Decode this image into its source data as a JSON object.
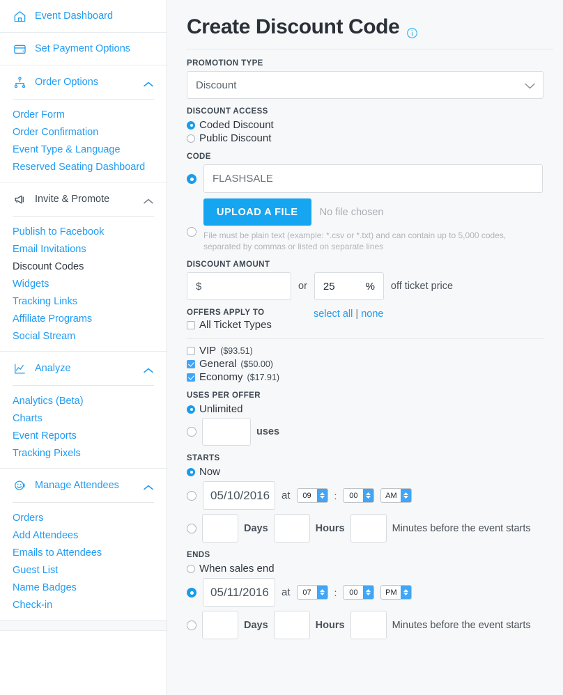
{
  "sidebar": {
    "top_items": [
      {
        "label": "Event Dashboard",
        "icon": "home-icon"
      },
      {
        "label": "Set Payment Options",
        "icon": "credit-card-icon"
      }
    ],
    "groups": [
      {
        "label": "Order Options",
        "icon": "sitemap-icon",
        "chevron": "chevron-up-icon",
        "active": false,
        "items": [
          "Order Form",
          "Order Confirmation",
          "Event Type & Language",
          "Reserved Seating Dashboard"
        ]
      },
      {
        "label": "Invite & Promote",
        "icon": "megaphone-icon",
        "chevron": "chevron-up-icon",
        "active": true,
        "items": [
          "Publish to Facebook",
          "Email Invitations",
          "Discount Codes",
          "Widgets",
          "Tracking Links",
          "Affiliate Programs",
          "Social Stream"
        ],
        "active_item": "Discount Codes"
      },
      {
        "label": "Analyze",
        "icon": "chart-line-icon",
        "chevron": "chevron-up-icon",
        "active": false,
        "items": [
          "Analytics (Beta)",
          "Charts",
          "Event Reports",
          "Tracking Pixels"
        ]
      },
      {
        "label": "Manage Attendees",
        "icon": "smiley-face-icon",
        "chevron": "chevron-up-icon",
        "active": false,
        "items": [
          "Orders",
          "Add Attendees",
          "Emails to Attendees",
          "Guest List",
          "Name Badges",
          "Check-in"
        ]
      }
    ]
  },
  "page": {
    "title": "Create Discount Code",
    "info_icon": "info-circle-icon"
  },
  "promotion_type": {
    "label": "PROMOTION TYPE",
    "value": "Discount",
    "chevron": "chevron-down-icon"
  },
  "discount_access": {
    "label": "DISCOUNT ACCESS",
    "options": [
      {
        "label": "Coded Discount",
        "selected": true
      },
      {
        "label": "Public Discount",
        "selected": false
      }
    ]
  },
  "code": {
    "label": "CODE",
    "value": "FLASHSALE",
    "code_radio_selected": true,
    "file_radio_selected": false,
    "upload_button": "UPLOAD A FILE",
    "no_file": "No file chosen",
    "help": "File must be plain text (example: *.csv or *.txt) and can contain up to 5,000 codes, separated by commas or listed on separate lines"
  },
  "discount_amount": {
    "label": "DISCOUNT AMOUNT",
    "currency_symbol": "$",
    "currency_value": "",
    "or": "or",
    "percent_value": "25",
    "percent_symbol": "%",
    "tail": "off ticket price"
  },
  "offers_apply_to": {
    "label": "OFFERS APPLY TO",
    "all_ticket_types": {
      "label": "All Ticket Types",
      "checked": false
    },
    "select_all": "select all",
    "pipe": "|",
    "none": "none",
    "tickets": [
      {
        "name": "VIP",
        "price": "($93.51)",
        "checked": false
      },
      {
        "name": "General",
        "price": "($50.00)",
        "checked": true
      },
      {
        "name": "Economy",
        "price": "($17.91)",
        "checked": true
      }
    ]
  },
  "uses_per_offer": {
    "label": "USES PER OFFER",
    "unlimited": {
      "label": "Unlimited",
      "selected": true
    },
    "limited": {
      "value": "",
      "unit": "uses",
      "selected": false
    }
  },
  "starts": {
    "label": "STARTS",
    "now": {
      "label": "Now",
      "selected": true
    },
    "on_date": {
      "selected": false,
      "date": "05/10/2016",
      "at": "at",
      "hour": "09",
      "colon": ":",
      "minute": "00",
      "meridiem": "AM"
    },
    "before": {
      "selected": false,
      "days": "",
      "days_label": "Days",
      "hours": "",
      "hours_label": "Hours",
      "minutes": "",
      "minutes_label": "Minutes before the event starts"
    }
  },
  "ends": {
    "label": "ENDS",
    "when_sales_end": {
      "label": "When sales end",
      "selected": false
    },
    "on_date": {
      "selected": true,
      "date": "05/11/2016",
      "at": "at",
      "hour": "07",
      "colon": ":",
      "minute": "00",
      "meridiem": "PM"
    },
    "before": {
      "selected": false,
      "days": "",
      "days_label": "Days",
      "hours": "",
      "hours_label": "Hours",
      "minutes": "",
      "minutes_label": "Minutes before the event starts"
    }
  },
  "colors": {
    "link_blue": "#229cf2",
    "accent_blue": "#16a5f0",
    "control_blue": "#42a5f5",
    "text_dark": "#2f3640",
    "bg": "#f7f8f9"
  }
}
